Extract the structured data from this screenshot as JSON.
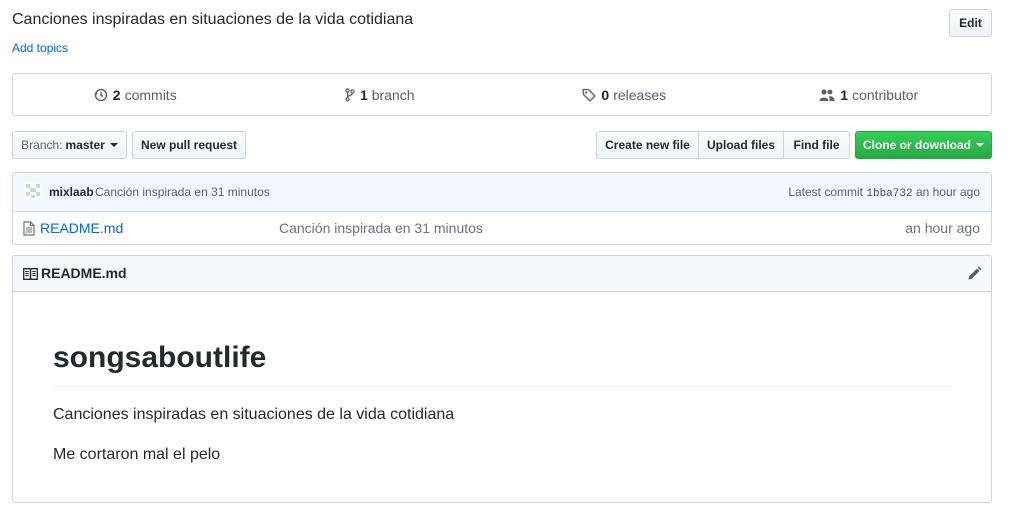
{
  "repo": {
    "description": "Canciones inspiradas en situaciones de la vida cotidiana",
    "add_topics": "Add topics",
    "edit_label": "Edit"
  },
  "summary": {
    "commits": {
      "count": "2",
      "label": "commits",
      "icon": "history-icon"
    },
    "branches": {
      "count": "1",
      "label": "branch",
      "icon": "branch-icon"
    },
    "releases": {
      "count": "0",
      "label": "releases",
      "icon": "tag-icon"
    },
    "contributors": {
      "count": "1",
      "label": "contributor",
      "icon": "people-icon"
    }
  },
  "file_nav": {
    "branch_prefix": "Branch:",
    "branch_name": "master",
    "new_pull_request": "New pull request",
    "create_new_file": "Create new file",
    "upload_files": "Upload files",
    "find_file": "Find file",
    "clone_or_download": "Clone or download"
  },
  "commit_tease": {
    "author": "mixlaab",
    "message": "Canción inspirada en 31 minutos",
    "latest_label": "Latest commit",
    "sha": "1bba732",
    "age": "an hour ago"
  },
  "files": [
    {
      "name": "README.md",
      "commit_message": "Canción inspirada en 31 minutos",
      "age": "an hour ago"
    }
  ],
  "readme": {
    "filename": "README.md",
    "heading": "songsaboutlife",
    "paragraphs": [
      "Canciones inspiradas en situaciones de la vida cotidiana",
      "Me cortaron mal el pelo"
    ]
  },
  "colors": {
    "link": "#0366d6",
    "green": "#28a745",
    "commit_bg": "#f1f8ff",
    "border": "#d1d5da"
  }
}
